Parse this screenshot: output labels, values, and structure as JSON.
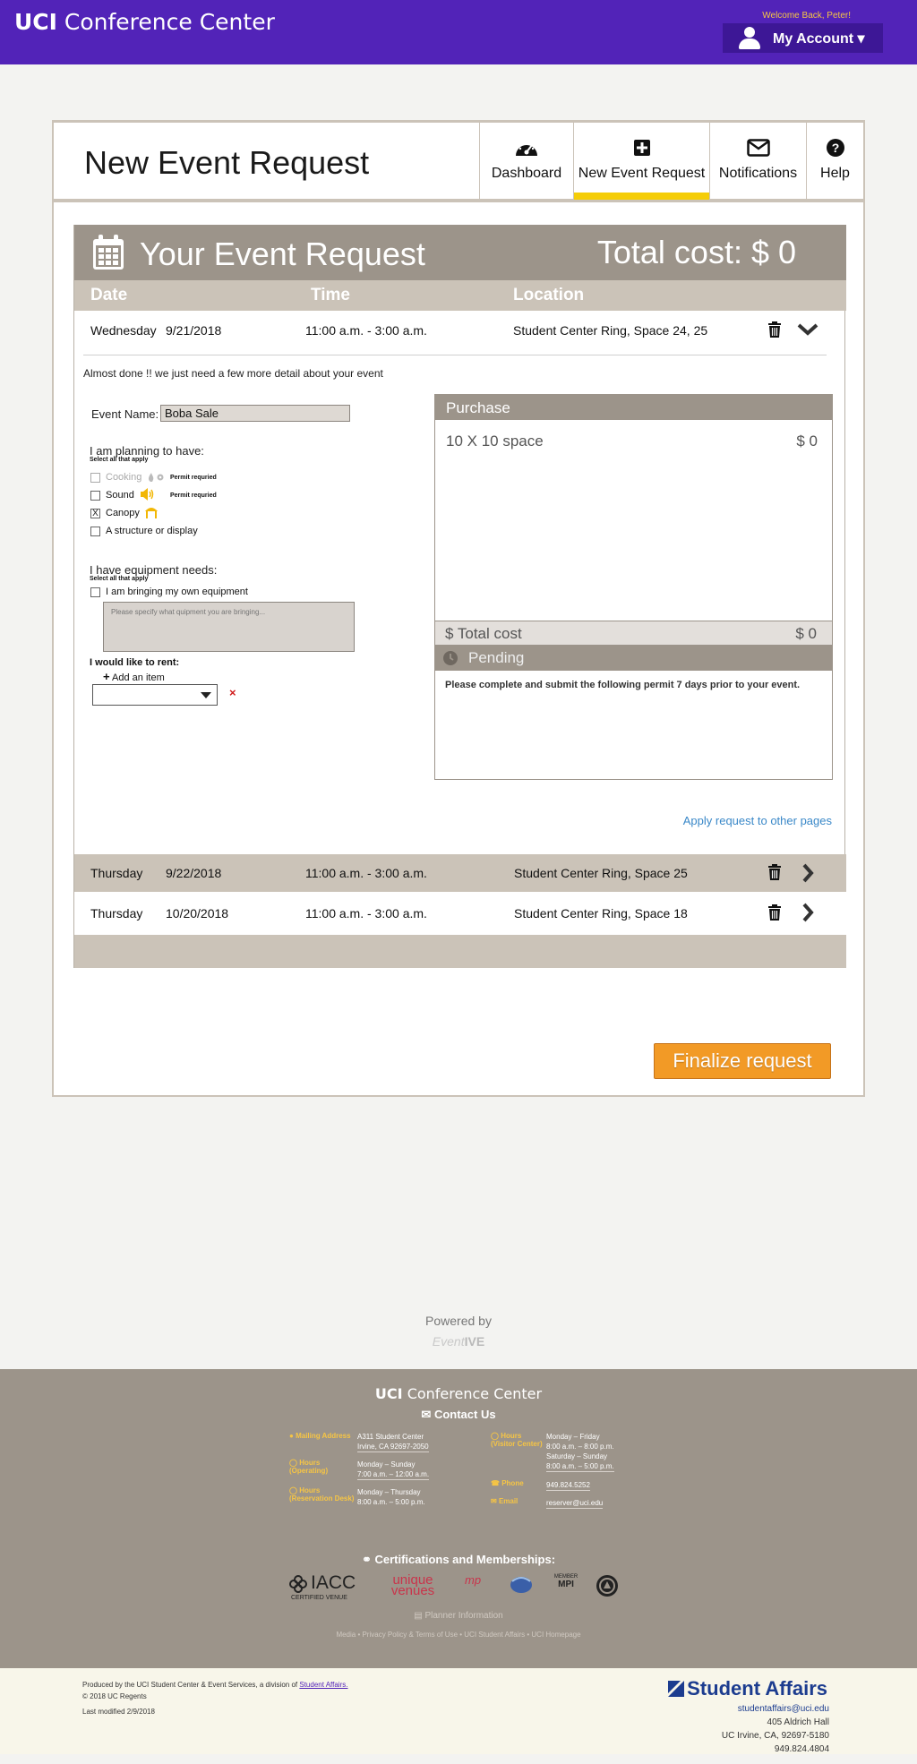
{
  "header": {
    "brand_bold": "UCI",
    "brand_rest": " Conference Center",
    "welcome": "Welcome Back, Peter!",
    "account_label": "My Account ▾"
  },
  "page": {
    "title": "New Event Request",
    "tabs": [
      {
        "label": "Dashboard",
        "icon": "dashboard-icon"
      },
      {
        "label": "New Event Request",
        "icon": "plus-square-icon",
        "active": true
      },
      {
        "label": "Notifications",
        "icon": "envelope-icon"
      },
      {
        "label": "Help",
        "icon": "question-circle-icon"
      }
    ]
  },
  "event": {
    "heading": "Your Event Request",
    "total_cost": "Total cost: $ 0",
    "columns": {
      "date": "Date",
      "time": "Time",
      "location": "Location"
    },
    "rows": [
      {
        "day": "Wednesday",
        "date": "9/21/2018",
        "time": "11:00 a.m. - 3:00 a.m.",
        "location": "Student Center Ring, Space 24, 25"
      },
      {
        "day": "Thursday",
        "date": "9/22/2018",
        "time": "11:00 a.m. - 3:00 a.m.",
        "location": "Student Center Ring, Space 25"
      },
      {
        "day": "Thursday",
        "date": "10/20/2018",
        "time": "11:00 a.m. - 3:00 a.m.",
        "location": "Student Center Ring, Space 18"
      }
    ],
    "hint": "Almost done !! we just need a few more detail about your event"
  },
  "form": {
    "event_name_label": "Event Name:",
    "event_name_value": "Boba Sale",
    "planning_label": "I am planning to have:",
    "select_all": "Select all that apply",
    "options": [
      {
        "label": "Cooking",
        "permit": "Permit requried",
        "checked": false,
        "disabled": true
      },
      {
        "label": "Sound",
        "permit": "Permit requried",
        "checked": false,
        "disabled": false
      },
      {
        "label": "Canopy",
        "permit": "",
        "checked": true,
        "disabled": false
      },
      {
        "label": "A structure or display",
        "permit": "",
        "checked": false,
        "disabled": false
      }
    ],
    "check_mark": "X",
    "equipment_label": "I have equipment needs:",
    "equipment_select_all": "Select all that apply",
    "own_equipment_label": "I am bringing my own equipment",
    "equipment_placeholder": "Please specify what quipment you are bringing...",
    "rent_label": "I would like to rent:",
    "add_item": "Add an item",
    "remove_x": "×"
  },
  "purchase": {
    "heading": "Purchase",
    "item": "10 X 10 space",
    "item_value": "$   0",
    "total_label": "$ Total cost",
    "total_value": "$ 0",
    "status": "Pending",
    "note": "Please complete and submit the following permit 7 days prior to your event."
  },
  "apply_link": "Apply request to other pages",
  "finalize": "Finalize request",
  "powered": {
    "label": "Powered by",
    "logo_italic": "Event",
    "logo_bold": "IVE"
  },
  "footer": {
    "brand_bold": "UCI",
    "brand_rest": " Conference Center",
    "contact": "Contact Us",
    "mailing_label": "Mailing Address",
    "mailing_1": "A311 Student Center",
    "mailing_2": "Irvine, CA 92697-2050",
    "hours_op_label_1": "Hours",
    "hours_op_label_2": "(Operating)",
    "hours_op_1": "Monday – Sunday",
    "hours_op_2": "7:00 a.m. – 12:00 a.m.",
    "hours_res_label_1": "Hours",
    "hours_res_label_2": "(Reservation Desk)",
    "hours_res_1": "Monday – Thursday",
    "hours_res_2": "8:00 a.m. – 5:00 p.m.",
    "hours_vis_label_1": "Hours",
    "hours_vis_label_2": "(Visitor Center)",
    "hours_vis_1": "Monday – Friday",
    "hours_vis_2": "8:00 a.m. – 8:00 p.m.",
    "hours_vis_3": "Saturday – Sunday",
    "hours_vis_4": "8:00 a.m. – 5:00 p.m.",
    "phone_label": "Phone",
    "phone": "949.824.5252",
    "email_label": "Email",
    "email": "reserver@uci.edu",
    "cert": "Certifications and Memberships:",
    "logos": {
      "iacc": "IACC",
      "iacc_sub": "CERTIFIED VENUE",
      "uv_top": "unique",
      "uv_bot": "venues",
      "mp": "mp",
      "mpi_top": "MEMBER",
      "mpi": "MPI"
    },
    "planner": "Planner Information",
    "links": "Media • Privacy Policy & Terms of Use • UCI Student Affairs • UCI Homepage"
  },
  "bottom": {
    "produced": "Produced by the UCI Student Center & Event Services, a division of",
    "produced_link": "Student Affairs.",
    "copyright": "© 2018 UC Regents",
    "modified": "Last modified 2/9/2018",
    "sa_logo": "Student Affairs",
    "sa_email": "studentaffairs@uci.edu",
    "sa_addr1": "405 Aldrich Hall",
    "sa_addr2": "UC Irvine, CA, 92697-5180",
    "sa_phone": "949.824.4804"
  },
  "colors": {
    "brand_purple": "#5223b8",
    "accent_yellow": "#f5cd08",
    "taupe": "#9c948a",
    "finalize_orange": "#f29a26",
    "link_blue": "#3a88c8"
  }
}
